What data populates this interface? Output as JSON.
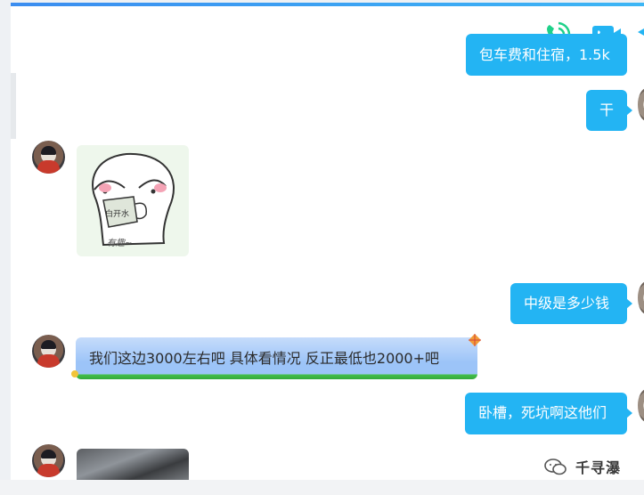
{
  "toolbar": {
    "icons": [
      "phone-call-icon",
      "video-call-icon",
      "more-icon"
    ]
  },
  "messages": {
    "out_partial": "包车费和住宿，1.5k",
    "out_1": "干",
    "sticker": {
      "label": "白开水",
      "caption": "有趣~"
    },
    "out_2": "中级是多少钱",
    "in_1": "我们这边3000左右吧   具体看情况 反正最低也2000+吧",
    "out_3": "卧槽，死坑啊这他们"
  },
  "watermark": {
    "text": "千寻瀑"
  },
  "colors": {
    "outgoing_bubble": "#23b4f3",
    "incoming_bubble": "#9cc4f8",
    "accent_green": "#33a93c",
    "phone_icon": "#1fd18a",
    "video_icon": "#23b4f3"
  }
}
